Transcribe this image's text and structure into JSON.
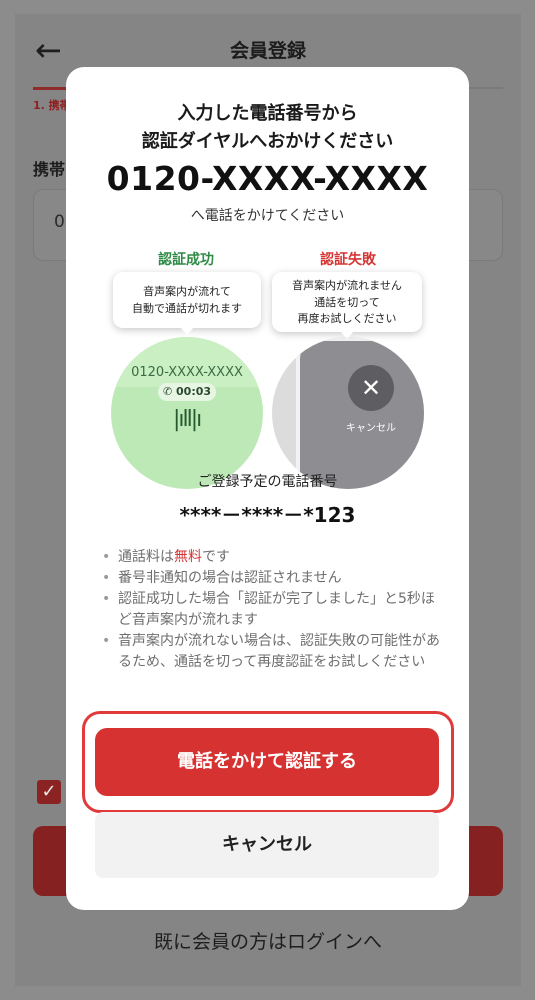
{
  "background": {
    "back_icon": "arrow-left-icon",
    "title": "会員登録",
    "step_label": "1. 携帯",
    "field_label": "携帯",
    "input_value": "0",
    "login_link": "既に会員の方はログインへ"
  },
  "modal": {
    "title_line1": "入力した電話番号から",
    "title_line2": "認証ダイヤルへおかけください",
    "phone_number": "0120-XXXX-XXXX",
    "phone_sub": "へ電話をかけてください",
    "success": {
      "label": "認証成功",
      "bubble_line1": "音声案内が流れて",
      "bubble_line2": "自動で通話が切れます",
      "screen_number": "0120-XXXX-XXXX",
      "timer": "00:03",
      "color": "#2f8a46"
    },
    "failure": {
      "label": "認証失敗",
      "bubble_line1": "音声案内が流れません",
      "bubble_line2": "通話を切って",
      "bubble_line3": "再度お試しください",
      "screen_cancel": "キャンセル",
      "color": "#d63535"
    },
    "registration_label": "ご登録予定の電話番号",
    "registration_number": "****－****－*123",
    "notes": [
      {
        "prefix": "通話料は",
        "highlight": "無料",
        "suffix": "です"
      },
      {
        "text": "番号非通知の場合は認証されません"
      },
      {
        "text": "認証成功した場合「認証が完了しました」と5秒ほど音声案内が流れます"
      },
      {
        "text": "音声案内が流れない場合は、認証失敗の可能性があるため、通話を切って再度認証をお試しください"
      }
    ],
    "primary_button": "電話をかけて認証する",
    "cancel_button": "キャンセル",
    "accent_color": "#d63232"
  }
}
